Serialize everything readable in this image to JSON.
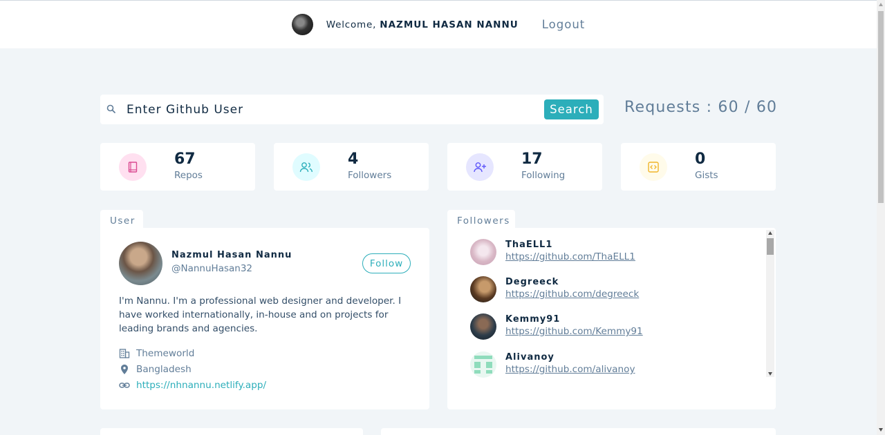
{
  "nav": {
    "welcome_prefix": "Welcome,",
    "username": "NAZMUL HASAN NANNU",
    "logout_label": "Logout"
  },
  "search": {
    "placeholder": "Enter Github User",
    "button_label": "Search",
    "requests_text": "Requests : 60 / 60"
  },
  "stats": [
    {
      "value": "67",
      "label": "Repos",
      "icon": "book-icon",
      "color": "#da4a91",
      "bg": "#ffe0f0"
    },
    {
      "value": "4",
      "label": "Followers",
      "icon": "users-icon",
      "color": "#2caeba",
      "bg": "#e0fcff"
    },
    {
      "value": "17",
      "label": "Following",
      "icon": "user-plus-icon",
      "color": "#5d55fa",
      "bg": "#e6e6ff"
    },
    {
      "value": "0",
      "label": "Gists",
      "icon": "code-icon",
      "color": "#f0b429",
      "bg": "#fffbea"
    }
  ],
  "user_card": {
    "tab_label": "User",
    "name": "Nazmul Hasan Nannu",
    "handle": "@NannuHasan32",
    "follow_label": "Follow",
    "bio": "I'm Nannu. I'm a professional web designer and developer. I have worked internationally, in-house and on projects for leading brands and agencies.",
    "company": "Themeworld",
    "location": "Bangladesh",
    "blog": "https://nhnannu.netlify.app/"
  },
  "followers_card": {
    "tab_label": "Followers",
    "items": [
      {
        "name": "ThaELL1",
        "url": "https://github.com/ThaELL1"
      },
      {
        "name": "Degreeck",
        "url": "https://github.com/degreeck"
      },
      {
        "name": "Kemmy91",
        "url": "https://github.com/Kemmy91"
      },
      {
        "name": "Alivanoy",
        "url": "https://github.com/alivanoy"
      }
    ]
  },
  "colors": {
    "accent": "#2caeba",
    "background": "#f1f5f8",
    "text_primary": "#102a42",
    "text_secondary": "#617d98"
  }
}
